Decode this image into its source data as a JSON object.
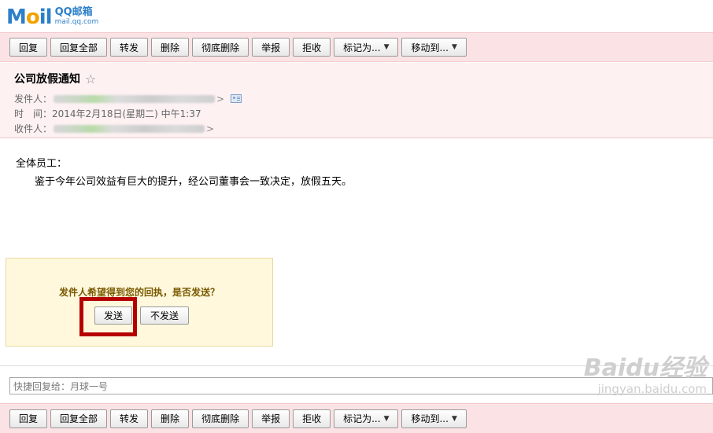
{
  "logo": {
    "mark_m": "M",
    "mark_o": "o",
    "mark_il": "il",
    "name": "QQ邮箱",
    "domain": "mail.qq.com"
  },
  "toolbar": {
    "reply": "回复",
    "reply_all": "回复全部",
    "forward": "转发",
    "delete": "删除",
    "delete_permanent": "彻底删除",
    "report": "举报",
    "reject": "拒收",
    "mark_as": "标记为...",
    "move_to": "移动到...",
    "caret": "▼"
  },
  "mail": {
    "subject": "公司放假通知",
    "star": "☆",
    "from_label": "发件人：",
    "time_label": "时　间：",
    "time_value": "2014年2月18日(星期二) 中午1:37",
    "to_label": "收件人：",
    "gt": ">",
    "body_greeting": "全体员工：",
    "body_text": "鉴于今年公司效益有巨大的提升，经公司董事会一致决定，放假五天。"
  },
  "receipt": {
    "question": "发件人希望得到您的回执，是否发送？",
    "send": "发送",
    "no_send": "不发送"
  },
  "quick_reply": {
    "placeholder": "快捷回复给：月球一号"
  },
  "watermark": {
    "brand": "Baidu经验",
    "site": "jingyan.baidu.com"
  },
  "colors": {
    "toolbar_bg": "#fbe3e5",
    "header_bg": "#fdf1f2",
    "receipt_bg": "#fff8dc",
    "highlight": "#b60000",
    "logo_blue": "#2c7fc9",
    "logo_orange": "#f0a300"
  }
}
